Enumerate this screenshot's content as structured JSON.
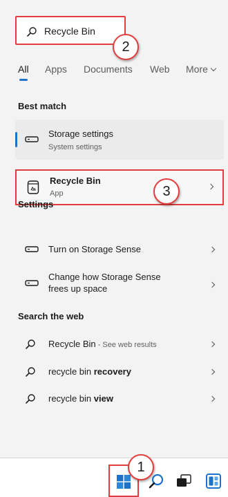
{
  "search": {
    "value": "Recycle Bin"
  },
  "tabs": [
    {
      "label": "All"
    },
    {
      "label": "Apps"
    },
    {
      "label": "Documents"
    },
    {
      "label": "Web"
    },
    {
      "label": "More"
    }
  ],
  "best_match": {
    "heading": "Best match",
    "items": [
      {
        "title": "Storage settings",
        "subtitle": "System settings",
        "icon": "storage-icon"
      },
      {
        "title": "Recycle Bin",
        "subtitle": "App",
        "icon": "recycle-bin-icon"
      }
    ]
  },
  "settings": {
    "heading": "Settings",
    "items": [
      {
        "title": "Turn on Storage Sense",
        "icon": "storage-icon"
      },
      {
        "title_line1": "Change how Storage Sense",
        "title_line2": "frees up space",
        "icon": "storage-icon"
      }
    ]
  },
  "web": {
    "heading": "Search the web",
    "items": [
      {
        "prefix": "Recycle Bin",
        "hint": " - See web results",
        "icon": "search-icon"
      },
      {
        "prefix": "recycle bin ",
        "bold": "recovery",
        "icon": "search-icon"
      },
      {
        "prefix": "recycle bin ",
        "bold": "view",
        "icon": "search-icon"
      }
    ]
  },
  "callouts": [
    "1",
    "2",
    "3"
  ],
  "taskbar": {
    "items": [
      "start-icon",
      "search-icon",
      "task-view-icon",
      "widgets-icon"
    ]
  },
  "colors": {
    "accent": "#1d73c9",
    "highlight": "#e23d3d"
  }
}
